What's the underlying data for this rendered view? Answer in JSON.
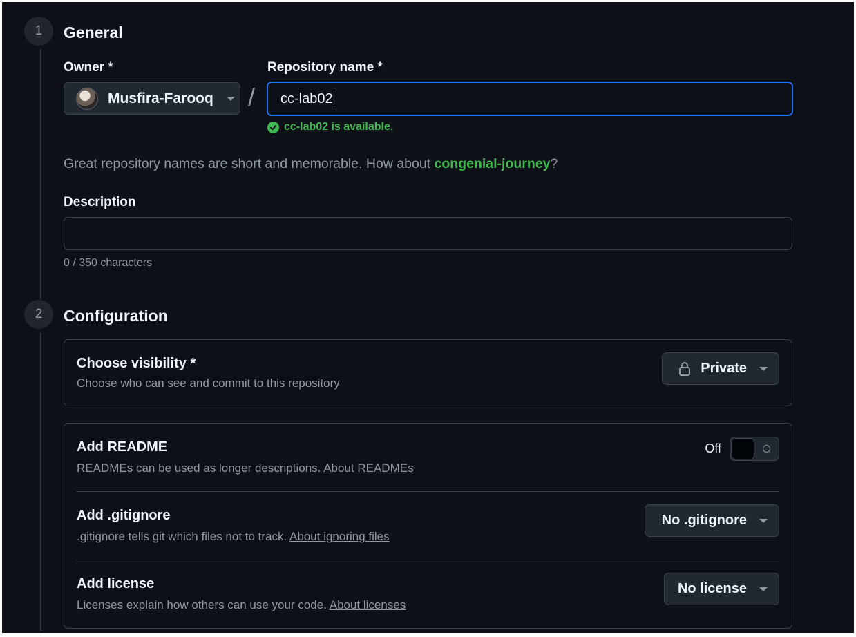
{
  "steps": [
    {
      "number": "1",
      "title": "General"
    },
    {
      "number": "2",
      "title": "Configuration"
    }
  ],
  "general": {
    "owner_label": "Owner *",
    "owner_name": "Musfira-Farooq",
    "separator": "/",
    "repo_label": "Repository name *",
    "repo_value": "cc-lab02",
    "availability": "cc-lab02 is available.",
    "hint_prefix": "Great repository names are short and memorable. How about ",
    "hint_suggestion": "congenial-journey",
    "hint_suffix": "?",
    "description_label": "Description",
    "description_value": "",
    "description_counter": "0 / 350 characters"
  },
  "configuration": {
    "visibility": {
      "title": "Choose visibility *",
      "subtitle": "Choose who can see and commit to this repository",
      "selected": "Private",
      "icon": "lock-icon"
    },
    "readme": {
      "title": "Add README",
      "subtitle": "READMEs can be used as longer descriptions. ",
      "link": "About READMEs",
      "toggle_label": "Off",
      "enabled": false
    },
    "gitignore": {
      "title": "Add .gitignore",
      "subtitle": ".gitignore tells git which files not to track. ",
      "link": "About ignoring files",
      "selected": "No .gitignore"
    },
    "license": {
      "title": "Add license",
      "subtitle": "Licenses explain how others can use your code. ",
      "link": "About licenses",
      "selected": "No license"
    }
  },
  "colors": {
    "background": "#0d1117",
    "accent_blue": "#1f6feb",
    "success_green": "#3fb950",
    "muted_text": "#9198a1"
  }
}
